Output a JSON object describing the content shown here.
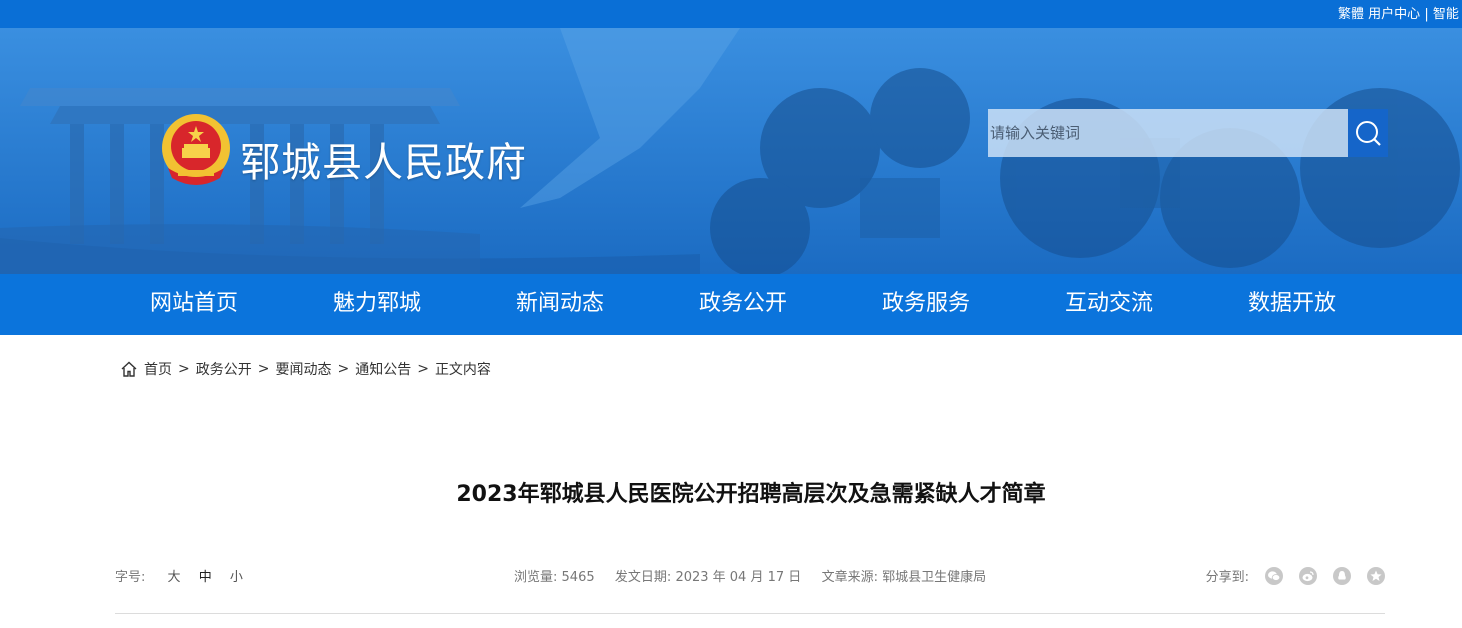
{
  "topbar": {
    "traditional": "繁體",
    "user_center": "用户中心",
    "separator": "|",
    "smart": "智能"
  },
  "header": {
    "site_title": "郓城县人民政府",
    "search_placeholder": "请输入关键词"
  },
  "nav": {
    "items": [
      "网站首页",
      "魅力郓城",
      "新闻动态",
      "政务公开",
      "政务服务",
      "互动交流",
      "数据开放"
    ]
  },
  "breadcrumb": {
    "items": [
      "首页",
      "政务公开",
      "要闻动态",
      "通知公告",
      "正文内容"
    ],
    "separator": ">"
  },
  "article": {
    "title": "2023年郓城县人民医院公开招聘高层次及急需紧缺人才简章",
    "font_size_label": "字号:",
    "font_size_options": [
      "大",
      "中",
      "小"
    ],
    "views_label": "浏览量:",
    "views": "5465",
    "date_label": "发文日期:",
    "date": "2023 年 04 月 17 日",
    "source_label": "文章来源:",
    "source": "郓城县卫生健康局",
    "share_label": "分享到:",
    "share_icons": [
      "wechat-icon",
      "weibo-icon",
      "qq-icon",
      "qzone-icon"
    ]
  },
  "colors": {
    "topbar": "#0a6fd6",
    "nav": "#0b74dc",
    "search_button": "#1565c9"
  }
}
